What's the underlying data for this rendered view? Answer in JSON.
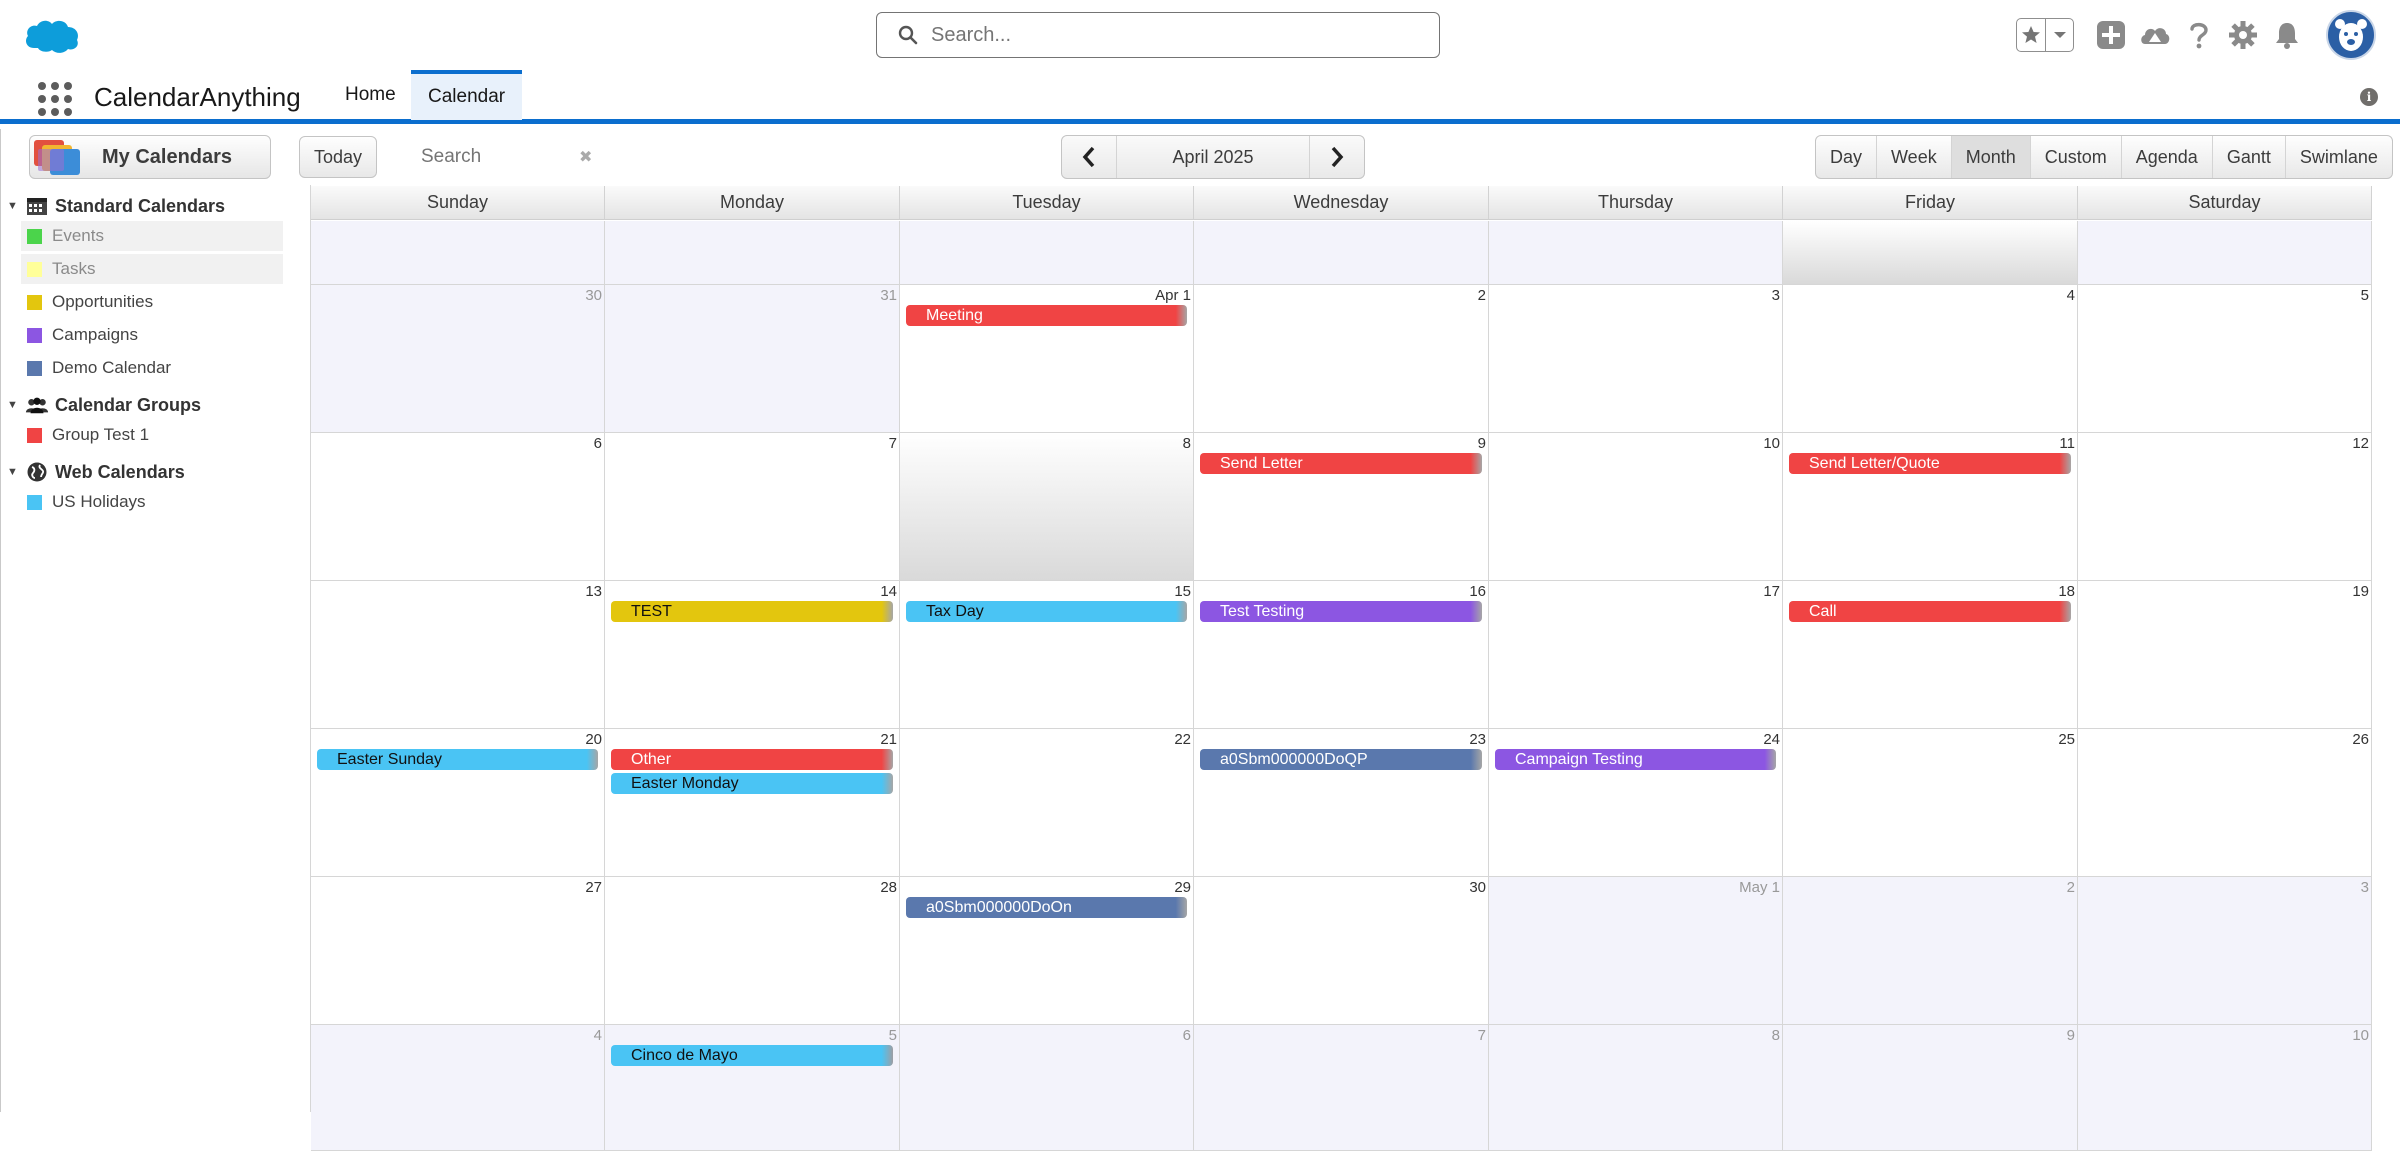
{
  "global": {
    "search_placeholder": "Search...",
    "icons": [
      "star-favorites-icon",
      "add-icon",
      "trailhead-icon",
      "help-icon",
      "setup-gear-icon",
      "notifications-bell-icon"
    ]
  },
  "nav": {
    "app_name": "CalendarAnything",
    "tabs": [
      {
        "label": "Home",
        "active": false
      },
      {
        "label": "Calendar",
        "active": true
      }
    ]
  },
  "toolbar": {
    "my_calendars": "My Calendars",
    "today": "Today",
    "search_placeholder": "Search",
    "month_title": "April 2025",
    "views": [
      {
        "label": "Day",
        "active": false
      },
      {
        "label": "Week",
        "active": false
      },
      {
        "label": "Month",
        "active": true
      },
      {
        "label": "Custom",
        "active": false
      },
      {
        "label": "Agenda",
        "active": false
      },
      {
        "label": "Gantt",
        "active": false
      },
      {
        "label": "Swimlane",
        "active": false
      }
    ]
  },
  "sidebar": {
    "groups": [
      {
        "label": "Standard Calendars",
        "icon": "calendar-grid-icon",
        "items": [
          {
            "label": "Events",
            "color": "#4bd44b",
            "enabled": false
          },
          {
            "label": "Tasks",
            "color": "#ffff99",
            "enabled": false
          },
          {
            "label": "Opportunities",
            "color": "#e3c60e",
            "enabled": true
          },
          {
            "label": "Campaigns",
            "color": "#8c56e2",
            "enabled": true
          },
          {
            "label": "Demo Calendar",
            "color": "#5a78ad",
            "enabled": true
          }
        ]
      },
      {
        "label": "Calendar Groups",
        "icon": "group-people-icon",
        "items": [
          {
            "label": "Group Test 1",
            "color": "#f04444",
            "enabled": true
          }
        ]
      },
      {
        "label": "Web Calendars",
        "icon": "globe-icon",
        "items": [
          {
            "label": "US Holidays",
            "color": "#4ac4f4",
            "enabled": true
          }
        ]
      }
    ]
  },
  "calendar": {
    "weekdays": [
      "Sunday",
      "Monday",
      "Tuesday",
      "Wednesday",
      "Thursday",
      "Friday",
      "Saturday"
    ],
    "weeks": [
      [
        {
          "label": "",
          "other": true
        },
        {
          "label": "",
          "other": true
        },
        {
          "label": "",
          "other": true
        },
        {
          "label": "",
          "other": true
        },
        {
          "label": "",
          "other": true
        },
        {
          "label": "",
          "other": true,
          "today": true
        },
        {
          "label": "",
          "other": true
        }
      ],
      [
        {
          "label": "30",
          "other": true
        },
        {
          "label": "31",
          "other": true
        },
        {
          "label": "Apr 1",
          "events": [
            {
              "title": "Meeting",
              "color": "#f04444"
            }
          ]
        },
        {
          "label": "2"
        },
        {
          "label": "3"
        },
        {
          "label": "4"
        },
        {
          "label": "5"
        }
      ],
      [
        {
          "label": "6"
        },
        {
          "label": "7"
        },
        {
          "label": "8",
          "today": true
        },
        {
          "label": "9",
          "events": [
            {
              "title": "Send Letter",
              "color": "#f04444"
            }
          ]
        },
        {
          "label": "10"
        },
        {
          "label": "11",
          "events": [
            {
              "title": "Send Letter/Quote",
              "color": "#f04444"
            }
          ]
        },
        {
          "label": "12"
        }
      ],
      [
        {
          "label": "13"
        },
        {
          "label": "14",
          "events": [
            {
              "title": "TEST",
              "color": "#e3c60e"
            }
          ]
        },
        {
          "label": "15",
          "events": [
            {
              "title": "Tax Day",
              "color": "#4ac4f4"
            }
          ]
        },
        {
          "label": "16",
          "events": [
            {
              "title": "Test Testing",
              "color": "#8c56e2"
            }
          ]
        },
        {
          "label": "17"
        },
        {
          "label": "18",
          "events": [
            {
              "title": "Call",
              "color": "#f04444"
            }
          ]
        },
        {
          "label": "19"
        }
      ],
      [
        {
          "label": "20",
          "events": [
            {
              "title": "Easter Sunday",
              "color": "#4ac4f4"
            }
          ]
        },
        {
          "label": "21",
          "events": [
            {
              "title": "Other",
              "color": "#f04444"
            },
            {
              "title": "Easter Monday",
              "color": "#4ac4f4"
            }
          ]
        },
        {
          "label": "22"
        },
        {
          "label": "23",
          "events": [
            {
              "title": "a0Sbm000000DoQP",
              "color": "#5a78ad"
            }
          ]
        },
        {
          "label": "24",
          "events": [
            {
              "title": "Campaign Testing",
              "color": "#8c56e2"
            }
          ]
        },
        {
          "label": "25"
        },
        {
          "label": "26"
        }
      ],
      [
        {
          "label": "27"
        },
        {
          "label": "28"
        },
        {
          "label": "29",
          "events": [
            {
              "title": "a0Sbm000000DoOn",
              "color": "#5a78ad"
            }
          ]
        },
        {
          "label": "30"
        },
        {
          "label": "May 1",
          "other": true
        },
        {
          "label": "2",
          "other": true
        },
        {
          "label": "3",
          "other": true
        }
      ],
      [
        {
          "label": "4",
          "other": true
        },
        {
          "label": "5",
          "other": true,
          "events": [
            {
              "title": "Cinco de Mayo",
              "color": "#4ac4f4"
            }
          ]
        },
        {
          "label": "6",
          "other": true
        },
        {
          "label": "7",
          "other": true
        },
        {
          "label": "8",
          "other": true
        },
        {
          "label": "9",
          "other": true
        },
        {
          "label": "10",
          "other": true
        }
      ]
    ]
  }
}
